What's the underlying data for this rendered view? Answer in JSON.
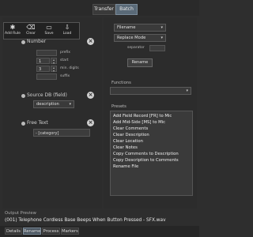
{
  "top_tabs": [
    {
      "label": "Transfer",
      "active": false
    },
    {
      "label": "Batch",
      "active": true
    }
  ],
  "toolbar": {
    "buttons": [
      {
        "label": "Add Rule",
        "icon": "add-rule-icon"
      },
      {
        "label": "Clear",
        "icon": "clear-icon"
      },
      {
        "label": "Save",
        "icon": "save-icon"
      },
      {
        "label": "Load",
        "icon": "load-icon"
      }
    ]
  },
  "number_section": {
    "title": "Number",
    "fields": [
      {
        "value": "",
        "label": "prefix"
      },
      {
        "value": "1",
        "label": "start"
      },
      {
        "value": "3",
        "label": "min. digits"
      },
      {
        "value": "",
        "label": "suffix"
      }
    ]
  },
  "source_section": {
    "title": "Source DB (field)",
    "selected": "description"
  },
  "free_text_section": {
    "title": "Free Text",
    "value": "- [category]"
  },
  "right": {
    "target_dropdown": "Filename",
    "mode_dropdown": "Replace Mode",
    "separator_label": "separator",
    "separator_value": "",
    "rename_button": "Rename",
    "functions_label": "Functions",
    "functions_value": "",
    "presets_label": "Presets",
    "presets": [
      "Add Field Record [FR] to Mic",
      "Add Mid-Side [MS] to Mic",
      "Clear Comments",
      "Clear Description",
      "Clear Location",
      "Clear Notes",
      "Copy Comments to Description",
      "Copy Description to Comments",
      "Rename File"
    ]
  },
  "output": {
    "label": "Output Preview",
    "value": "(001) Telephone Cordless Base Beeps When Button Pressed - SFX.wav"
  },
  "bottom_tabs": [
    {
      "label": "Details",
      "active": false
    },
    {
      "label": "Rename",
      "active": true
    },
    {
      "label": "Process",
      "active": false
    },
    {
      "label": "Markers",
      "active": false
    }
  ]
}
